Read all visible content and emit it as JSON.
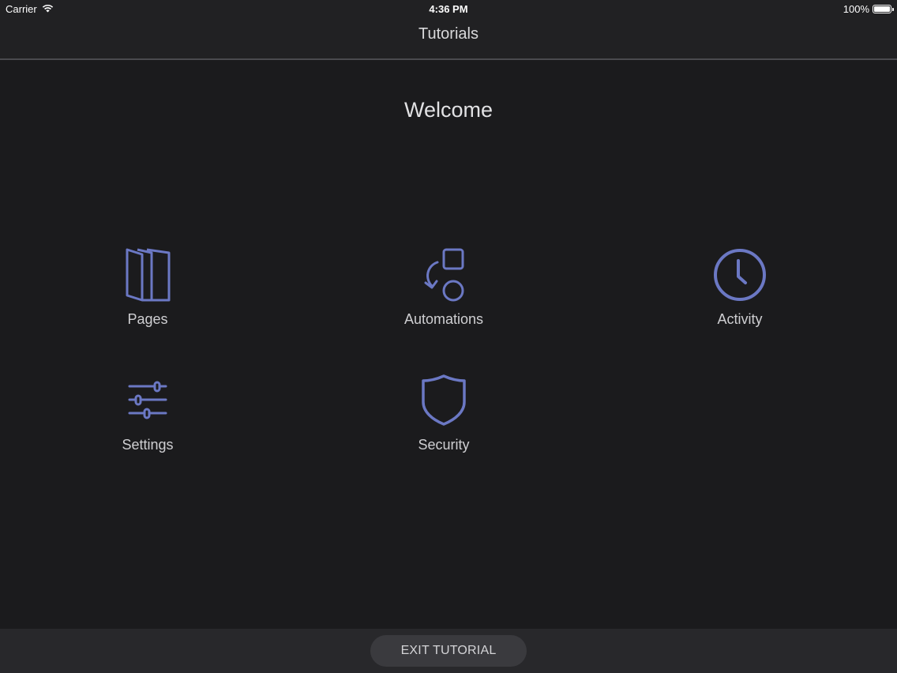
{
  "status_bar": {
    "carrier": "Carrier",
    "time": "4:36 PM",
    "battery": "100%",
    "battery_level": 1.0
  },
  "nav": {
    "title": "Tutorials"
  },
  "content": {
    "heading": "Welcome",
    "tiles": [
      {
        "label": "Pages",
        "icon": "pages-icon"
      },
      {
        "label": "Automations",
        "icon": "automations-icon"
      },
      {
        "label": "Activity",
        "icon": "activity-clock-icon"
      },
      {
        "label": "Settings",
        "icon": "settings-sliders-icon"
      },
      {
        "label": "Security",
        "icon": "security-shield-icon"
      }
    ]
  },
  "bottom_bar": {
    "exit_label": "EXIT TUTORIAL"
  },
  "colors": {
    "background": "#1b1b1d",
    "icon_accent": "#6b78c4",
    "bar_background": "#212123",
    "button_background": "#3a3a3e"
  }
}
